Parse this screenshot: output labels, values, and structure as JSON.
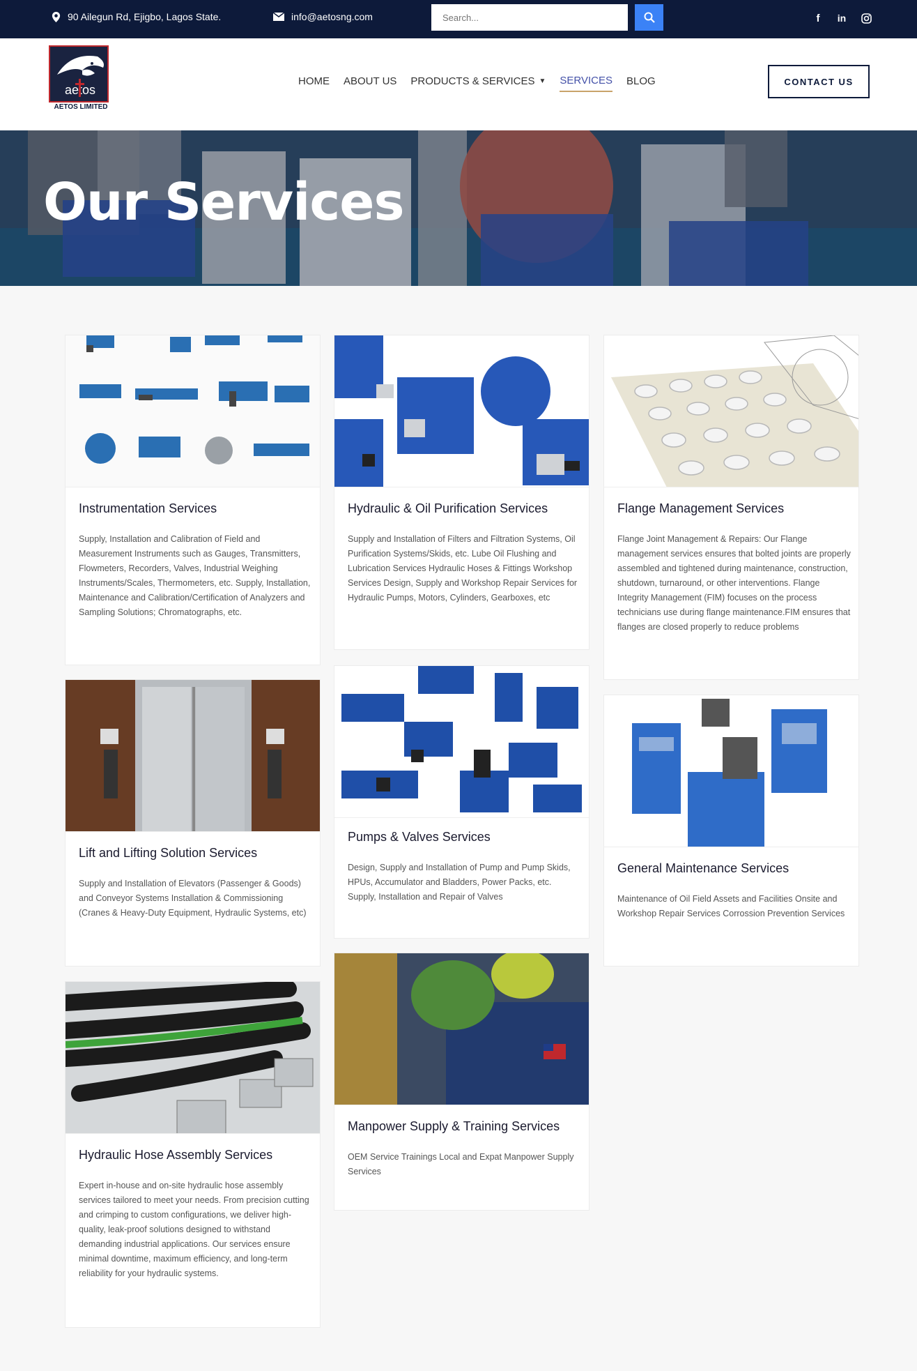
{
  "topbar": {
    "address": "90 Ailegun Rd, Ejigbo, Lagos State.",
    "email": "info@aetosng.com",
    "search_placeholder": "Search..."
  },
  "header": {
    "logo_text": "AETOS LIMITED",
    "logo_word": "aetos",
    "nav": [
      {
        "label": "HOME"
      },
      {
        "label": "ABOUT US"
      },
      {
        "label": "PRODUCTS & SERVICES"
      },
      {
        "label": "SERVICES"
      },
      {
        "label": "BLOG"
      }
    ],
    "contact_label": "CONTACT US"
  },
  "hero": {
    "title": "Our Services"
  },
  "services": [
    {
      "title": "Instrumentation Services",
      "text": "Supply, Installation and Calibration of Field and Measurement Instruments such as Gauges, Transmitters, Flowmeters, Recorders, Valves, Industrial Weighing Instruments/Scales, Thermometers, etc. Supply, Installation, Maintenance and Calibration/Certification of Analyzers and Sampling Solutions; Chromatographs, etc."
    },
    {
      "title": "Hydraulic & Oil Purification Services",
      "text": "Supply and Installation of Filters and Filtration Systems, Oil Purification Systems/Skids, etc. Lube Oil Flushing and Lubrication Services Hydraulic Hoses & Fittings Workshop Services Design, Supply and Workshop Repair Services for Hydraulic Pumps, Motors, Cylinders, Gearboxes, etc"
    },
    {
      "title": "Flange Management Services",
      "text": "Flange Joint Management & Repairs: Our Flange management services ensures that bolted joints are properly assembled and tightened during maintenance, construction, shutdown, turnaround, or other interventions. Flange Integrity Management (FIM) focuses on the process technicians use during flange maintenance.FIM ensures that flanges are closed properly to reduce problems"
    },
    {
      "title": "Lift and Lifting Solution Services",
      "text": "Supply and Installation of Elevators (Passenger & Goods) and Conveyor Systems Installation & Commissioning (Cranes & Heavy-Duty Equipment, Hydraulic Systems, etc)"
    },
    {
      "title": "Pumps & Valves Services",
      "text": "Design, Supply and Installation of Pump and Pump Skids, HPUs, Accumulator and Bladders, Power Packs, etc. Supply, Installation and Repair of Valves"
    },
    {
      "title": "General Maintenance Services",
      "text": "Maintenance of Oil Field Assets and Facilities Onsite and Workshop Repair Services Corrossion Prevention Services"
    },
    {
      "title": "Hydraulic Hose Assembly Services",
      "text": "Expert in-house and on-site hydraulic hose assembly services tailored to meet your needs. From precision cutting and crimping to custom configurations, we deliver high-quality, leak-proof solutions designed to withstand demanding industrial applications. Our services ensure minimal downtime, maximum efficiency, and long-term reliability for your hydraulic systems."
    },
    {
      "title": "Manpower Supply & Training Services",
      "text": "OEM Service Trainings Local and Expat Manpower Supply Services"
    }
  ],
  "colors": {
    "navy": "#0d1a3a",
    "accent": "#3b82f6",
    "active_nav": "#4451a8"
  }
}
